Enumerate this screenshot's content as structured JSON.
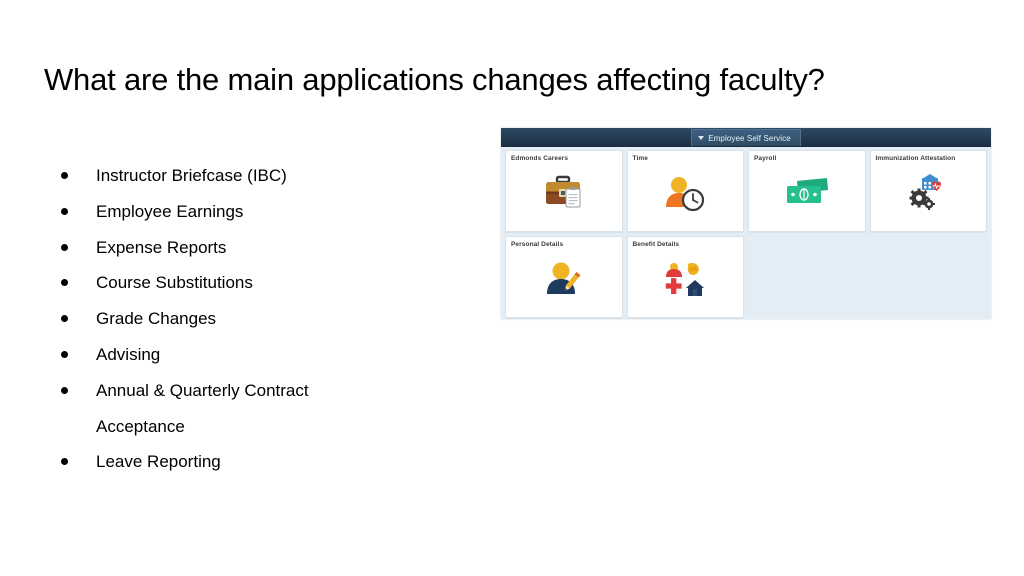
{
  "slide": {
    "title": "What are the main applications changes affecting faculty?"
  },
  "bullets": [
    {
      "label": "Instructor Briefcase (IBC)"
    },
    {
      "label": "Employee Earnings"
    },
    {
      "label": "Expense Reports"
    },
    {
      "label": "Course Substitutions"
    },
    {
      "label": "Grade Changes"
    },
    {
      "label": "Advising"
    },
    {
      "label": "Annual & Quarterly Contract Acceptance"
    },
    {
      "label": "Leave Reporting"
    }
  ],
  "screenshot": {
    "header": {
      "tab_label": "Employee Self Service",
      "caret_icon": "chevron-down-icon",
      "bar_color": "#243c53",
      "tab_color": "#35566f"
    },
    "panel_background": "#e3edf5",
    "tiles": [
      {
        "label": "Edmonds Careers",
        "icon": "briefcase-clipboard-icon"
      },
      {
        "label": "Time",
        "icon": "person-clock-icon"
      },
      {
        "label": "Payroll",
        "icon": "cash-banknotes-icon"
      },
      {
        "label": "Immunization Attestation",
        "icon": "gears-health-icon"
      },
      {
        "label": "Personal Details",
        "icon": "person-pencil-icon"
      },
      {
        "label": "Benefit Details",
        "icon": "benefits-grid-icon"
      }
    ]
  }
}
